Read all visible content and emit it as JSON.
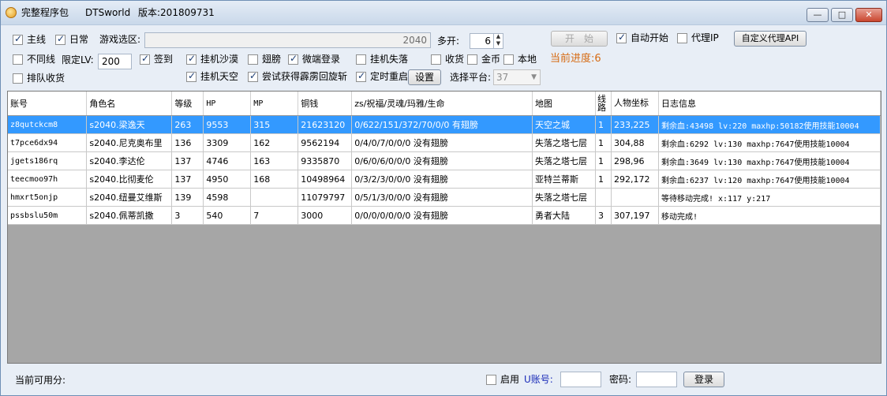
{
  "window": {
    "title": "完整程序包",
    "brand": "DTSworld",
    "version": "版本:201809731",
    "min_glyph": "—",
    "max_glyph": "□",
    "close_glyph": "✕"
  },
  "options": {
    "main_line": {
      "label": "主线",
      "checked": true
    },
    "daily": {
      "label": "日常",
      "checked": true
    },
    "zone_label": "游戏选区:",
    "zone_value": "2040",
    "multi_label": "多开:",
    "multi_value": "6",
    "start_button": "开　始",
    "auto_start": {
      "label": "自动开始",
      "checked": true
    },
    "proxy_ip": {
      "label": "代理IP",
      "checked": false
    },
    "custom_proxy_button": "自定义代理API",
    "no_same_line": {
      "label": "不同线",
      "checked": false
    },
    "limit_lv_label": "限定LV:",
    "limit_lv_value": "200",
    "sign_in": {
      "label": "签到",
      "checked": true
    },
    "hang_desert": {
      "label": "挂机沙漠",
      "checked": true
    },
    "wings": {
      "label": "翅膀",
      "checked": false
    },
    "micro_login": {
      "label": "微端登录",
      "checked": true
    },
    "hang_lost_tower": {
      "label": "挂机失落",
      "checked": false
    },
    "collect_goods": {
      "label": "收货",
      "checked": false
    },
    "gold": {
      "label": "金币",
      "checked": false
    },
    "local": {
      "label": "本地",
      "checked": false
    },
    "progress_label": "当前进度:",
    "progress_value": "6",
    "queue_collect": {
      "label": "排队收货",
      "checked": false
    },
    "hang_sky": {
      "label": "挂机天空",
      "checked": true
    },
    "try_thunder": {
      "label": "尝试获得霹雳回旋斩",
      "checked": true
    },
    "timed_restart": {
      "label": "定时重启",
      "checked": true
    },
    "settings_button": "设置",
    "platform_label": "选择平台:",
    "platform_value": "37"
  },
  "table": {
    "columns": [
      "账号",
      "角色名",
      "等级",
      "HP",
      "MP",
      "铜钱",
      "zs/祝福/灵魂/玛雅/生命",
      "地图",
      "线路",
      "人物坐标",
      "日志信息"
    ],
    "rows": [
      {
        "account": "z8qutckcm8",
        "role": "s2040.梁逸天",
        "level": "263",
        "hp": "9553",
        "mp": "315",
        "copper": "21623120",
        "zs": "0/622/151/372/70/0/0   有翅膀",
        "map": "天空之城",
        "line": "1",
        "coord": "233,225",
        "log": "剩余血:43498  lv:220  maxhp:50182使用技能10004"
      },
      {
        "account": "t7pce6dx94",
        "role": "s2040.尼克奥布里",
        "level": "136",
        "hp": "3309",
        "mp": "162",
        "copper": "9562194",
        "zs": "0/4/0/7/0/0/0   没有翅膀",
        "map": "失落之塔七层",
        "line": "1",
        "coord": "304,88",
        "log": "剩余血:6292  lv:130  maxhp:7647使用技能10004"
      },
      {
        "account": "jgets186rq",
        "role": "s2040.李达伦",
        "level": "137",
        "hp": "4746",
        "mp": "163",
        "copper": "9335870",
        "zs": "0/6/0/6/0/0/0   没有翅膀",
        "map": "失落之塔七层",
        "line": "1",
        "coord": "298,96",
        "log": "剩余血:3649  lv:130  maxhp:7647使用技能10004"
      },
      {
        "account": "teecmoo97h",
        "role": "s2040.比彻麦伦",
        "level": "137",
        "hp": "4950",
        "mp": "168",
        "copper": "10498964",
        "zs": "0/3/2/3/0/0/0   没有翅膀",
        "map": "亚特兰蒂斯",
        "line": "1",
        "coord": "292,172",
        "log": "剩余血:6237  lv:120  maxhp:7647使用技能10004"
      },
      {
        "account": "hmxrt5onjp",
        "role": "s2040.纽曼艾维斯",
        "level": "139",
        "hp": "4598",
        "mp": "",
        "copper": "11079797",
        "zs": "0/5/1/3/0/0/0   没有翅膀",
        "map": "失落之塔七层",
        "line": "",
        "coord": "",
        "log": "等待移动完成! x:117 y:217"
      },
      {
        "account": "pssbslu50m",
        "role": "s2040.佩蒂凯撒",
        "level": "3",
        "hp": "540",
        "mp": "7",
        "copper": "3000",
        "zs": "0/0/0/0/0/0/0   没有翅膀",
        "map": "勇者大陆",
        "line": "3",
        "coord": "307,197",
        "log": "移动完成!"
      }
    ]
  },
  "status": {
    "points_label": "当前可用分:",
    "enable": {
      "label": "启用",
      "checked": false
    },
    "u_account_label": "U账号:",
    "password_label": "密码:",
    "login_button": "登录"
  },
  "colors": {
    "selection": "#3399ff",
    "progress": "#d66a12",
    "u_account": "#1a2bb8"
  }
}
